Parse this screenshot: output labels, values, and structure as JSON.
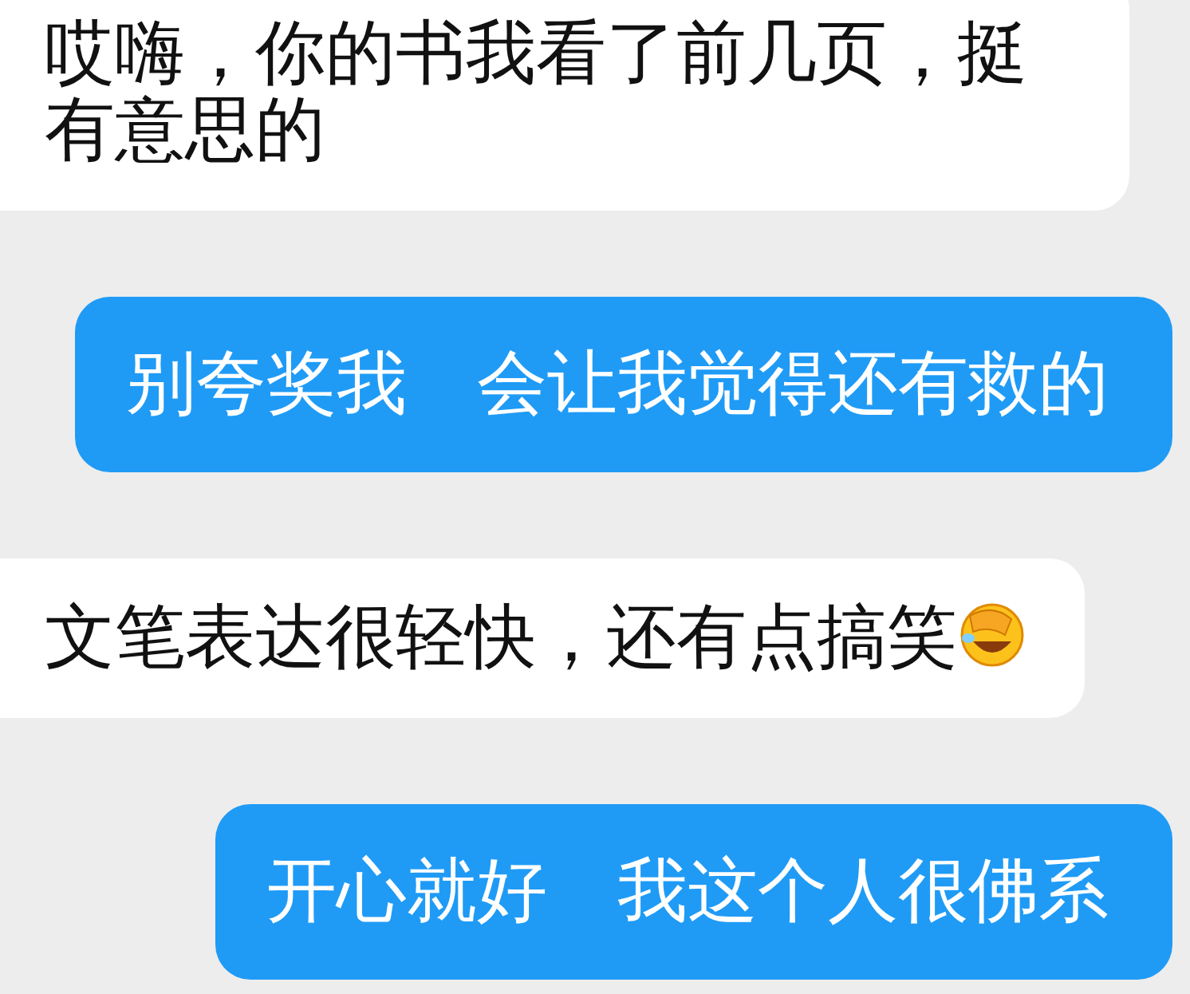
{
  "messages": [
    {
      "kind": "received",
      "text": "哎嗨，你的书我看了前几页，挺有意思的",
      "has_emoji": false
    },
    {
      "kind": "sent",
      "text": "别夸奖我　会让我觉得还有救的",
      "has_emoji": false
    },
    {
      "kind": "received",
      "text": "文笔表达很轻快，还有点搞笑",
      "has_emoji": true
    },
    {
      "kind": "sent",
      "text": "开心就好　我这个人很佛系",
      "has_emoji": false
    }
  ]
}
